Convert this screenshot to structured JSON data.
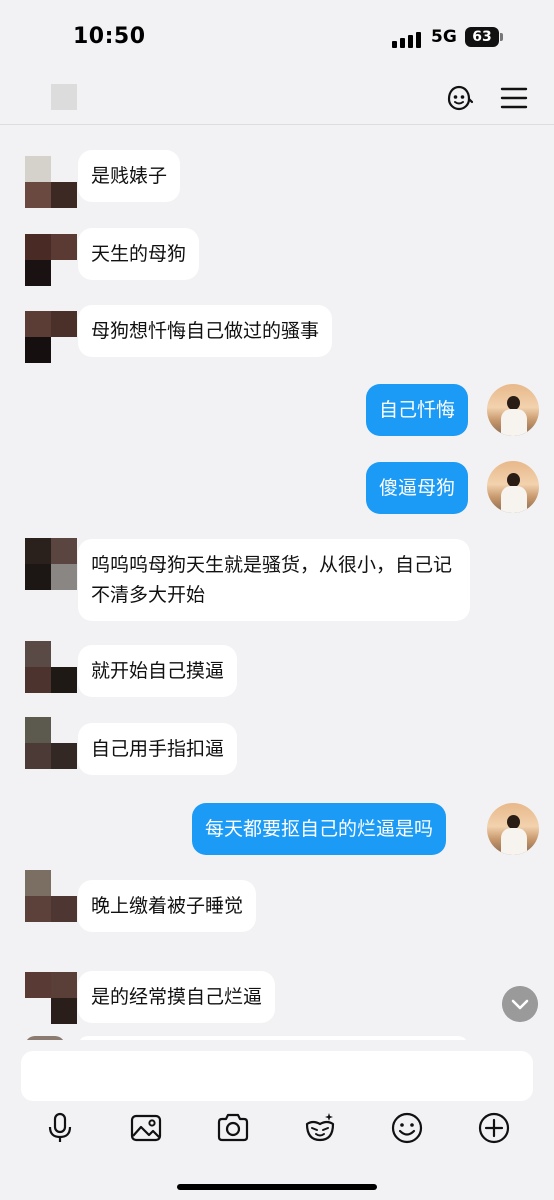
{
  "status_bar": {
    "time": "10:50",
    "network": "5G",
    "battery": "63"
  },
  "header": {
    "robot_icon": "robot-face-icon",
    "menu_icon": "hamburger-menu-icon"
  },
  "messages": [
    {
      "from": "them",
      "text": "是贱婊子"
    },
    {
      "from": "them",
      "text": "天生的母狗"
    },
    {
      "from": "them",
      "text": "母狗想忏悔自己做过的骚事"
    },
    {
      "from": "me",
      "text": "自己忏悔"
    },
    {
      "from": "me",
      "text": "傻逼母狗"
    },
    {
      "from": "them",
      "text": "呜呜呜母狗天生就是骚货，从很小，自己记不清多大开始"
    },
    {
      "from": "them",
      "text": "就开始自己摸逼"
    },
    {
      "from": "them",
      "text": "自己用手指扣逼"
    },
    {
      "from": "me",
      "text": "每天都要抠自己的烂逼是吗"
    },
    {
      "from": "them",
      "text": "晚上缴着被子睡觉"
    },
    {
      "from": "them",
      "text": "是的经常摸自己烂逼"
    }
  ],
  "input": {
    "placeholder": ""
  },
  "toolbar": [
    "microphone-icon",
    "image-icon",
    "camera-icon",
    "sticker-icon",
    "emoji-icon",
    "plus-icon"
  ],
  "colors": {
    "outgoing_bubble": "#1c9bf6",
    "incoming_bubble": "#ffffff",
    "background": "#f2f2f4"
  }
}
